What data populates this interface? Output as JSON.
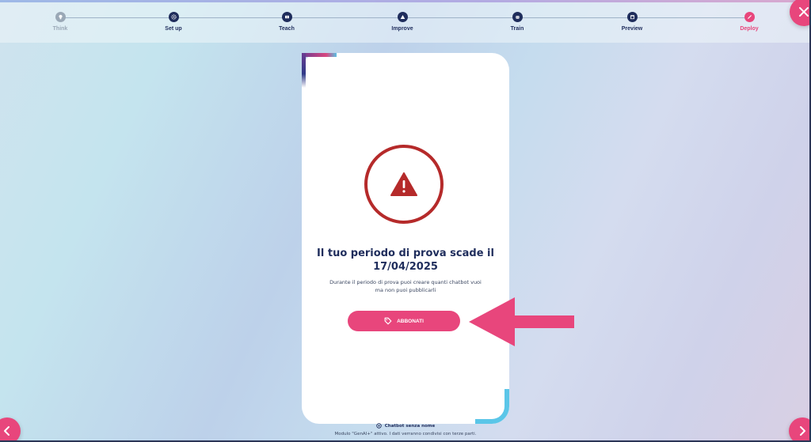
{
  "stepper": {
    "steps": [
      {
        "label": "Think",
        "state": "done",
        "icon": "lightbulb-icon"
      },
      {
        "label": "Set up",
        "state": "normal",
        "icon": "gear-icon"
      },
      {
        "label": "Teach",
        "state": "normal",
        "icon": "book-icon"
      },
      {
        "label": "Improve",
        "state": "normal",
        "icon": "chart-icon"
      },
      {
        "label": "Train",
        "state": "normal",
        "icon": "robot-icon"
      },
      {
        "label": "Preview",
        "state": "normal",
        "icon": "calendar-icon"
      },
      {
        "label": "Deploy",
        "state": "active",
        "icon": "pencil-icon"
      }
    ]
  },
  "card": {
    "title_line1": "Il tuo periodo di prova scade il",
    "title_line2": "17/04/2025",
    "desc_line1": "Durante il periodo di prova puoi creare quanti chatbot vuoi",
    "desc_line2": "ma non puoi pubblicarli",
    "cta_label": "ABBONATI"
  },
  "footer": {
    "bot_name": "Chatbot senza nome",
    "note": "Modulo \"GenAI+\" attivo. I dati verranno condivisi con terze parti."
  },
  "colors": {
    "accent": "#e8467c",
    "navy": "#1f2d5c",
    "warning": "#b52a2a",
    "cyan": "#5bc6e8"
  }
}
